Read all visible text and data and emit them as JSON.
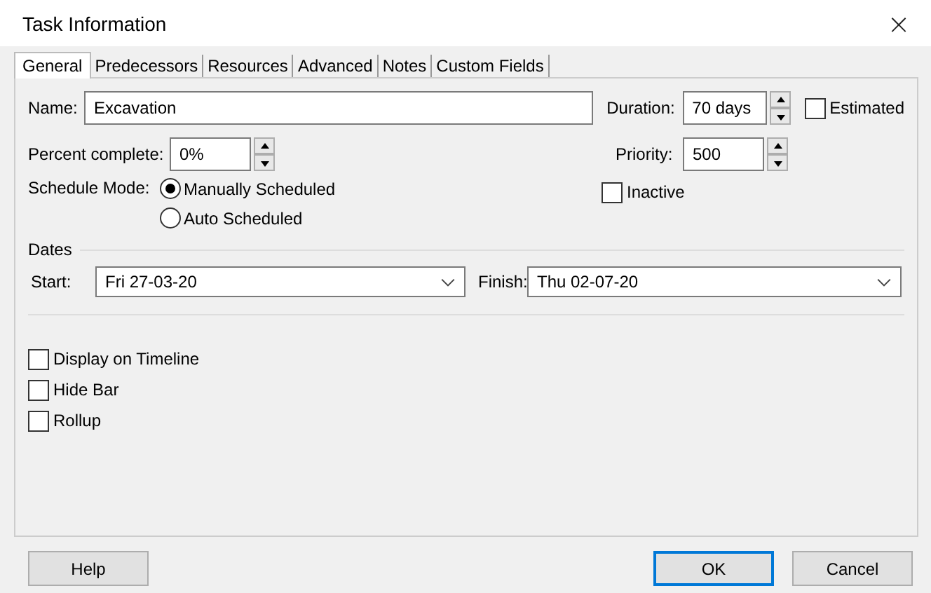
{
  "window": {
    "title": "Task Information",
    "close": "×"
  },
  "tabs": [
    {
      "label": "General",
      "selected": true
    },
    {
      "label": "Predecessors",
      "selected": false
    },
    {
      "label": "Resources",
      "selected": false
    },
    {
      "label": "Advanced",
      "selected": false
    },
    {
      "label": "Notes",
      "selected": false
    },
    {
      "label": "Custom Fields",
      "selected": false
    }
  ],
  "name": {
    "label": "Name:",
    "value": "Excavation"
  },
  "duration": {
    "label": "Duration:",
    "value": "70 days"
  },
  "estimated": {
    "label": "Estimated",
    "checked": false
  },
  "percent_complete": {
    "label": "Percent complete:",
    "value": "0%"
  },
  "priority": {
    "label": "Priority:",
    "value": "500"
  },
  "schedule_mode": {
    "label": "Schedule Mode:",
    "options": [
      {
        "label": "Manually Scheduled",
        "selected": true
      },
      {
        "label": "Auto Scheduled",
        "selected": false
      }
    ]
  },
  "inactive": {
    "label": "Inactive",
    "checked": false
  },
  "dates": {
    "heading": "Dates",
    "start": {
      "label": "Start:",
      "value": "Fri 27-03-20"
    },
    "finish": {
      "label": "Finish:",
      "value": "Thu 02-07-20"
    }
  },
  "options": [
    {
      "label": "Display on Timeline",
      "checked": false
    },
    {
      "label": "Hide Bar",
      "checked": false
    },
    {
      "label": "Rollup",
      "checked": false
    }
  ],
  "buttons": [
    {
      "label": "Help",
      "kind": "help"
    },
    {
      "label": "OK",
      "kind": "default"
    },
    {
      "label": "Cancel",
      "kind": "normal"
    }
  ]
}
